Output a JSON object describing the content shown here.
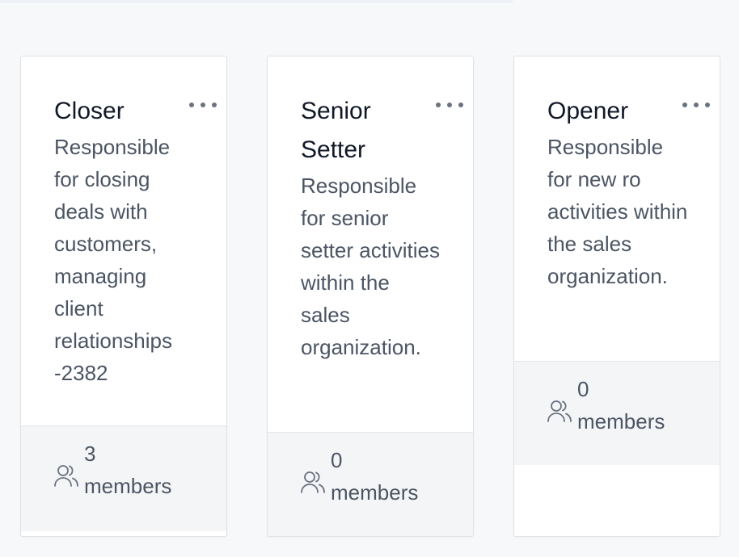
{
  "cards": [
    {
      "title": "Closer",
      "description": "Responsible for closing deals with customers, managing client relationships -2382",
      "members_count": "3",
      "members_label": "members"
    },
    {
      "title": "Senior Setter",
      "description": "Responsible for senior setter activities within the sales organization.",
      "members_count": "0",
      "members_label": "members"
    },
    {
      "title": "Opener",
      "description": "Responsible for new ro activities within the sales organization.",
      "members_count": "0",
      "members_label": "members"
    }
  ],
  "icons": {
    "more": "more-horizontal-icon",
    "members": "users-icon"
  },
  "colors": {
    "card_bg": "#ffffff",
    "footer_bg": "#f4f5f7",
    "page_bg": "#f7f8fa",
    "title_text": "#111827",
    "body_text": "#4b5563"
  }
}
